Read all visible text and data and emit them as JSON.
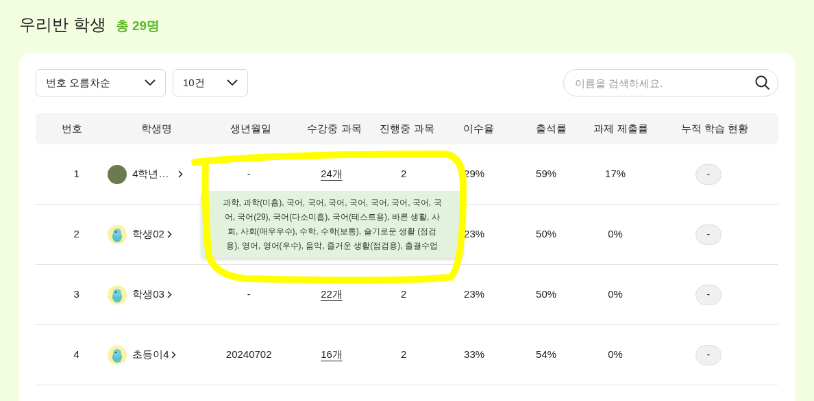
{
  "page_title": "우리반 학생",
  "total_count": "총 29명",
  "filters": {
    "sort": "번호 오름차순",
    "page_size": "10건"
  },
  "search": {
    "placeholder": "이름을 검색하세요."
  },
  "table": {
    "columns": [
      "번호",
      "학생명",
      "생년월일",
      "수강중 과목",
      "진행중 과목",
      "이수율",
      "출석률",
      "과제 제출률",
      "누적 학습 현황"
    ],
    "rows": [
      {
        "number": "1",
        "avatar": {
          "kind": "photo"
        },
        "name": "4학년…",
        "birthdate": "-",
        "courses": "24개",
        "ongoing": "2",
        "completion": "29%",
        "attendance": "59%",
        "submission": "17%",
        "history": "-",
        "course_tooltip": "과학, 과학(미흡), 국어, 국어, 국어, 국어, 국어, 국어, 국어, 국어, 국어(29), 국어(다소미흡), 국어(테스트용), 바른 생활, 사회, 사회(매우우수), 수학, 수학(보통), 슬기로운 생활 (점검용), 영어, 영어(우수), 음악, 즐거운 생활(점검용), 출결수업"
      },
      {
        "number": "2",
        "avatar": {
          "kind": "bird"
        },
        "name": "학생02",
        "completion": "23%",
        "attendance": "50%",
        "submission": "0%",
        "history": "-"
      },
      {
        "number": "3",
        "avatar": {
          "kind": "bird"
        },
        "name": "학생03",
        "birthdate": "-",
        "courses": "22개",
        "ongoing": "2",
        "completion": "23%",
        "attendance": "50%",
        "submission": "0%",
        "history": "-"
      },
      {
        "number": "4",
        "avatar": {
          "kind": "bird"
        },
        "name": "초등이4",
        "birthdate": "20240702",
        "courses": "16개",
        "ongoing": "2",
        "completion": "33%",
        "attendance": "54%",
        "submission": "0%",
        "history": "-"
      }
    ]
  }
}
